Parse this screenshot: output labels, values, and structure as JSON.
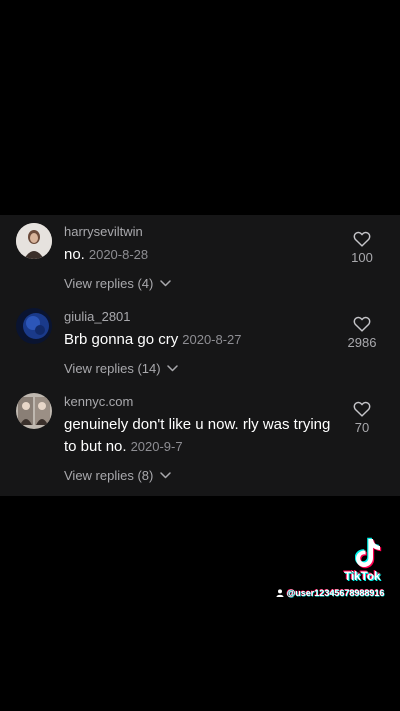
{
  "comments": [
    {
      "username": "harryseviltwin",
      "text": "no.",
      "date": "2020-8-28",
      "replies": "View replies (4)",
      "likes": "100"
    },
    {
      "username": "giulia_2801",
      "text": "Brb gonna go cry",
      "date": "2020-8-27",
      "replies": "View replies (14)",
      "likes": "2986"
    },
    {
      "username": "kennyc.com",
      "text": "genuinely don't like u now. rly was trying to but no.",
      "date": "2020-9-7",
      "replies": "View replies (8)",
      "likes": "70"
    }
  ],
  "watermark": {
    "brand": "TikTok",
    "handle": "@user12345678988916"
  },
  "colors": {
    "panel": "#161617",
    "secondary_text": "#a9a9ad",
    "background": "#000000"
  },
  "icons": [
    "heart-outline-icon",
    "chevron-down-icon",
    "tiktok-logo-icon",
    "user-icon"
  ]
}
